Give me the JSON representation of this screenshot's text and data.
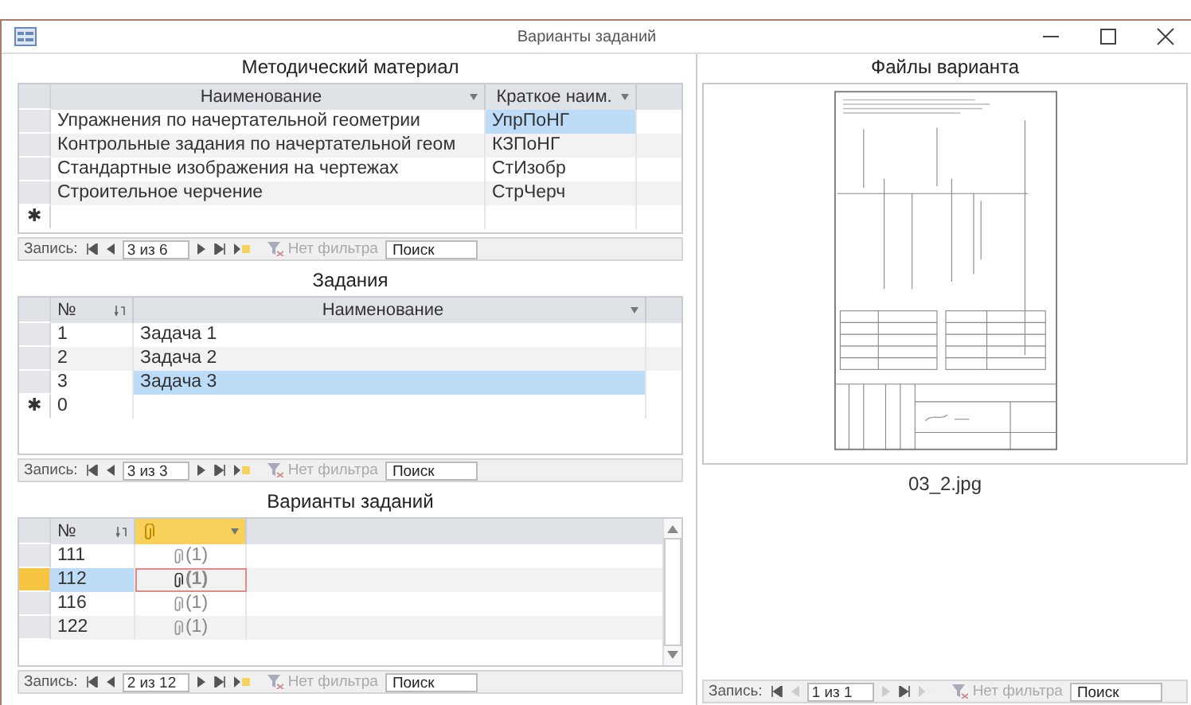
{
  "window": {
    "title": "Варианты заданий"
  },
  "sections": [
    {
      "title": "Методический материал",
      "new_marker": "✱",
      "columns": [
        "Наименование",
        "Краткое наим."
      ],
      "rows": [
        {
          "cells": [
            {
              "text": "Упражнения по начертательной геометрии",
              "selected": false
            },
            {
              "text": "УпрПоНГ",
              "selected": true
            }
          ]
        },
        {
          "cells": [
            {
              "text": "Контрольные задания по начертательной геом",
              "selected": false
            },
            {
              "text": "КЗПоНГ",
              "selected": false
            }
          ]
        },
        {
          "cells": [
            {
              "text": "Стандартные изображения на чертежах",
              "selected": false
            },
            {
              "text": "СтИзобр",
              "selected": false
            }
          ]
        },
        {
          "cells": [
            {
              "text": "Строительное черчение",
              "selected": false
            },
            {
              "text": "СтрЧерч",
              "selected": false
            }
          ]
        }
      ],
      "nav": {
        "label": "Запись:",
        "position": "3 из 6",
        "filter": "Нет фильтра",
        "search_placeholder": "Поиск",
        "disabled": false
      }
    },
    {
      "title": "Задания",
      "new_marker": "✱",
      "columns": [
        "№",
        "Наименование"
      ],
      "rows": [
        {
          "cells": [
            {
              "text": "1",
              "selected": false
            },
            {
              "text": "Задача 1",
              "selected": false
            }
          ]
        },
        {
          "cells": [
            {
              "text": "2",
              "selected": false
            },
            {
              "text": "Задача 2",
              "selected": false
            }
          ]
        },
        {
          "cells": [
            {
              "text": "3",
              "selected": false
            },
            {
              "text": "Задача 3",
              "selected": true
            }
          ]
        }
      ],
      "new_row": [
        "0"
      ],
      "nav": {
        "label": "Запись:",
        "position": "3 из 3",
        "filter": "Нет фильтра",
        "search_placeholder": "Поиск",
        "disabled": false
      }
    },
    {
      "title": "Варианты заданий",
      "columns": [
        "№",
        ""
      ],
      "scrollbar": true,
      "rows": [
        {
          "current": false,
          "cells": [
            {
              "text": "111",
              "selected": false,
              "focused": false
            },
            {
              "kind": "attachment",
              "text": "(1)",
              "selected": false,
              "focused": false
            }
          ]
        },
        {
          "current": true,
          "cells": [
            {
              "text": "112",
              "selected": true,
              "focused": false
            },
            {
              "kind": "attachment",
              "text": "(1)",
              "selected": false,
              "focused": true
            }
          ]
        },
        {
          "current": false,
          "cells": [
            {
              "text": "116",
              "selected": false,
              "focused": false
            },
            {
              "kind": "attachment",
              "text": "(1)",
              "selected": false,
              "focused": false
            }
          ]
        },
        {
          "current": false,
          "cells": [
            {
              "text": "122",
              "selected": false,
              "focused": false
            },
            {
              "kind": "attachment",
              "text": "(1)",
              "selected": false,
              "focused": false
            }
          ]
        }
      ],
      "nav": {
        "label": "Запись:",
        "position": "2 из 12",
        "filter": "Нет фильтра",
        "search_placeholder": "Поиск",
        "disabled": false
      }
    }
  ],
  "files": {
    "title": "Файлы варианта",
    "caption": "03_2.jpg",
    "nav": {
      "label": "Запись:",
      "position": "1 из 1",
      "filter": "Нет фильтра",
      "search_placeholder": "Поиск",
      "disabled": true
    }
  }
}
